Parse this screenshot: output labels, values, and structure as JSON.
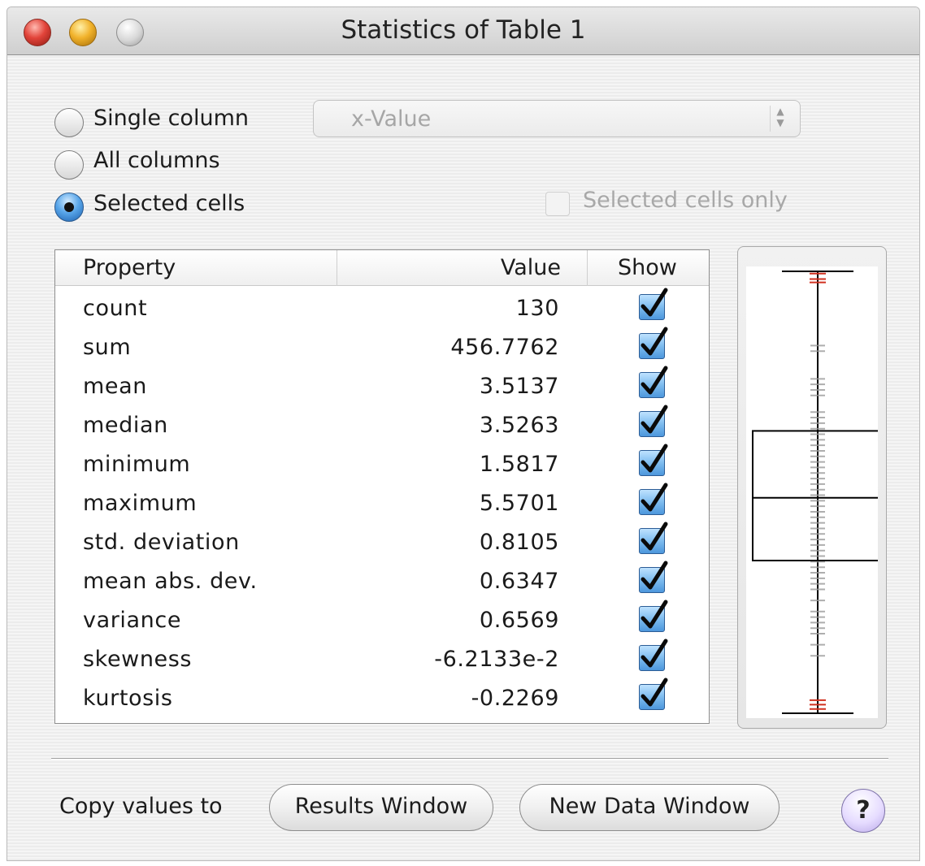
{
  "window": {
    "title": "Statistics of Table 1"
  },
  "mode": {
    "options": [
      "Single column",
      "All columns",
      "Selected cells"
    ],
    "selected": "Selected cells",
    "column_popup_value": "x-Value",
    "selected_cells_only_label": "Selected cells only"
  },
  "table": {
    "headers": {
      "property": "Property",
      "value": "Value",
      "show": "Show"
    },
    "rows": [
      {
        "property": "count",
        "value": "130",
        "show": true
      },
      {
        "property": "sum",
        "value": "456.7762",
        "show": true
      },
      {
        "property": "mean",
        "value": "3.5137",
        "show": true
      },
      {
        "property": "median",
        "value": "3.5263",
        "show": true
      },
      {
        "property": "minimum",
        "value": "1.5817",
        "show": true
      },
      {
        "property": "maximum",
        "value": "5.5701",
        "show": true
      },
      {
        "property": "std. deviation",
        "value": "0.8105",
        "show": true
      },
      {
        "property": "mean abs. dev.",
        "value": "0.6347",
        "show": true
      },
      {
        "property": "variance",
        "value": "0.6569",
        "show": true
      },
      {
        "property": "skewness",
        "value": "-6.2133e-2",
        "show": true
      },
      {
        "property": "kurtosis",
        "value": "-0.2269",
        "show": true
      }
    ]
  },
  "footer": {
    "copy_label": "Copy values to",
    "results_button": "Results Window",
    "new_data_button": "New Data Window",
    "help_label": "?"
  },
  "box_plot": {
    "min": 1.5817,
    "max": 5.5701,
    "median": 3.5263,
    "box_low": 2.96,
    "box_high": 4.13,
    "whisker_color": "#000000",
    "outlier_tick_color": "#d0301f"
  }
}
